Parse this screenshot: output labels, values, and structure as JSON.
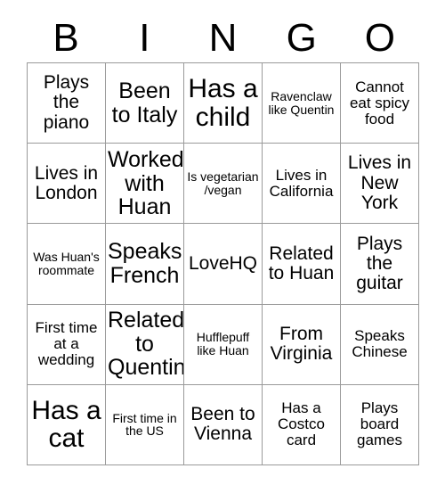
{
  "card": {
    "header_letters": [
      "B",
      "I",
      "N",
      "G",
      "O"
    ],
    "border_color": "#9a9a9a",
    "text_color": "#000000",
    "background_color": "#ffffff",
    "rows": 5,
    "columns": 5,
    "cells": [
      {
        "text": "Plays the piano",
        "size": "md"
      },
      {
        "text": "Been to Italy",
        "size": "lg"
      },
      {
        "text": "Has a child",
        "size": "xl"
      },
      {
        "text": "Ravenclaw like Quentin",
        "size": "xs"
      },
      {
        "text": "Cannot eat spicy food",
        "size": "sm"
      },
      {
        "text": "Lives in London",
        "size": "md"
      },
      {
        "text": "Worked with Huan",
        "size": "lg"
      },
      {
        "text": "Is vegetarian /vegan",
        "size": "xs"
      },
      {
        "text": "Lives in California",
        "size": "sm"
      },
      {
        "text": "Lives in New York",
        "size": "md"
      },
      {
        "text": "Was Huan's roommate",
        "size": "xs"
      },
      {
        "text": "Speaks French",
        "size": "lg"
      },
      {
        "text": "LoveHQ",
        "size": "md"
      },
      {
        "text": "Related to Huan",
        "size": "md"
      },
      {
        "text": "Plays the guitar",
        "size": "md"
      },
      {
        "text": "First time at a wedding",
        "size": "sm"
      },
      {
        "text": "Related to Quentin",
        "size": "lg"
      },
      {
        "text": "Hufflepuff like Huan",
        "size": "xs"
      },
      {
        "text": "From Virginia",
        "size": "md"
      },
      {
        "text": "Speaks Chinese",
        "size": "sm"
      },
      {
        "text": "Has a cat",
        "size": "xl"
      },
      {
        "text": "First time in the US",
        "size": "xs"
      },
      {
        "text": "Been to Vienna",
        "size": "md"
      },
      {
        "text": "Has a Costco card",
        "size": "sm"
      },
      {
        "text": "Plays board games",
        "size": "sm"
      }
    ]
  }
}
